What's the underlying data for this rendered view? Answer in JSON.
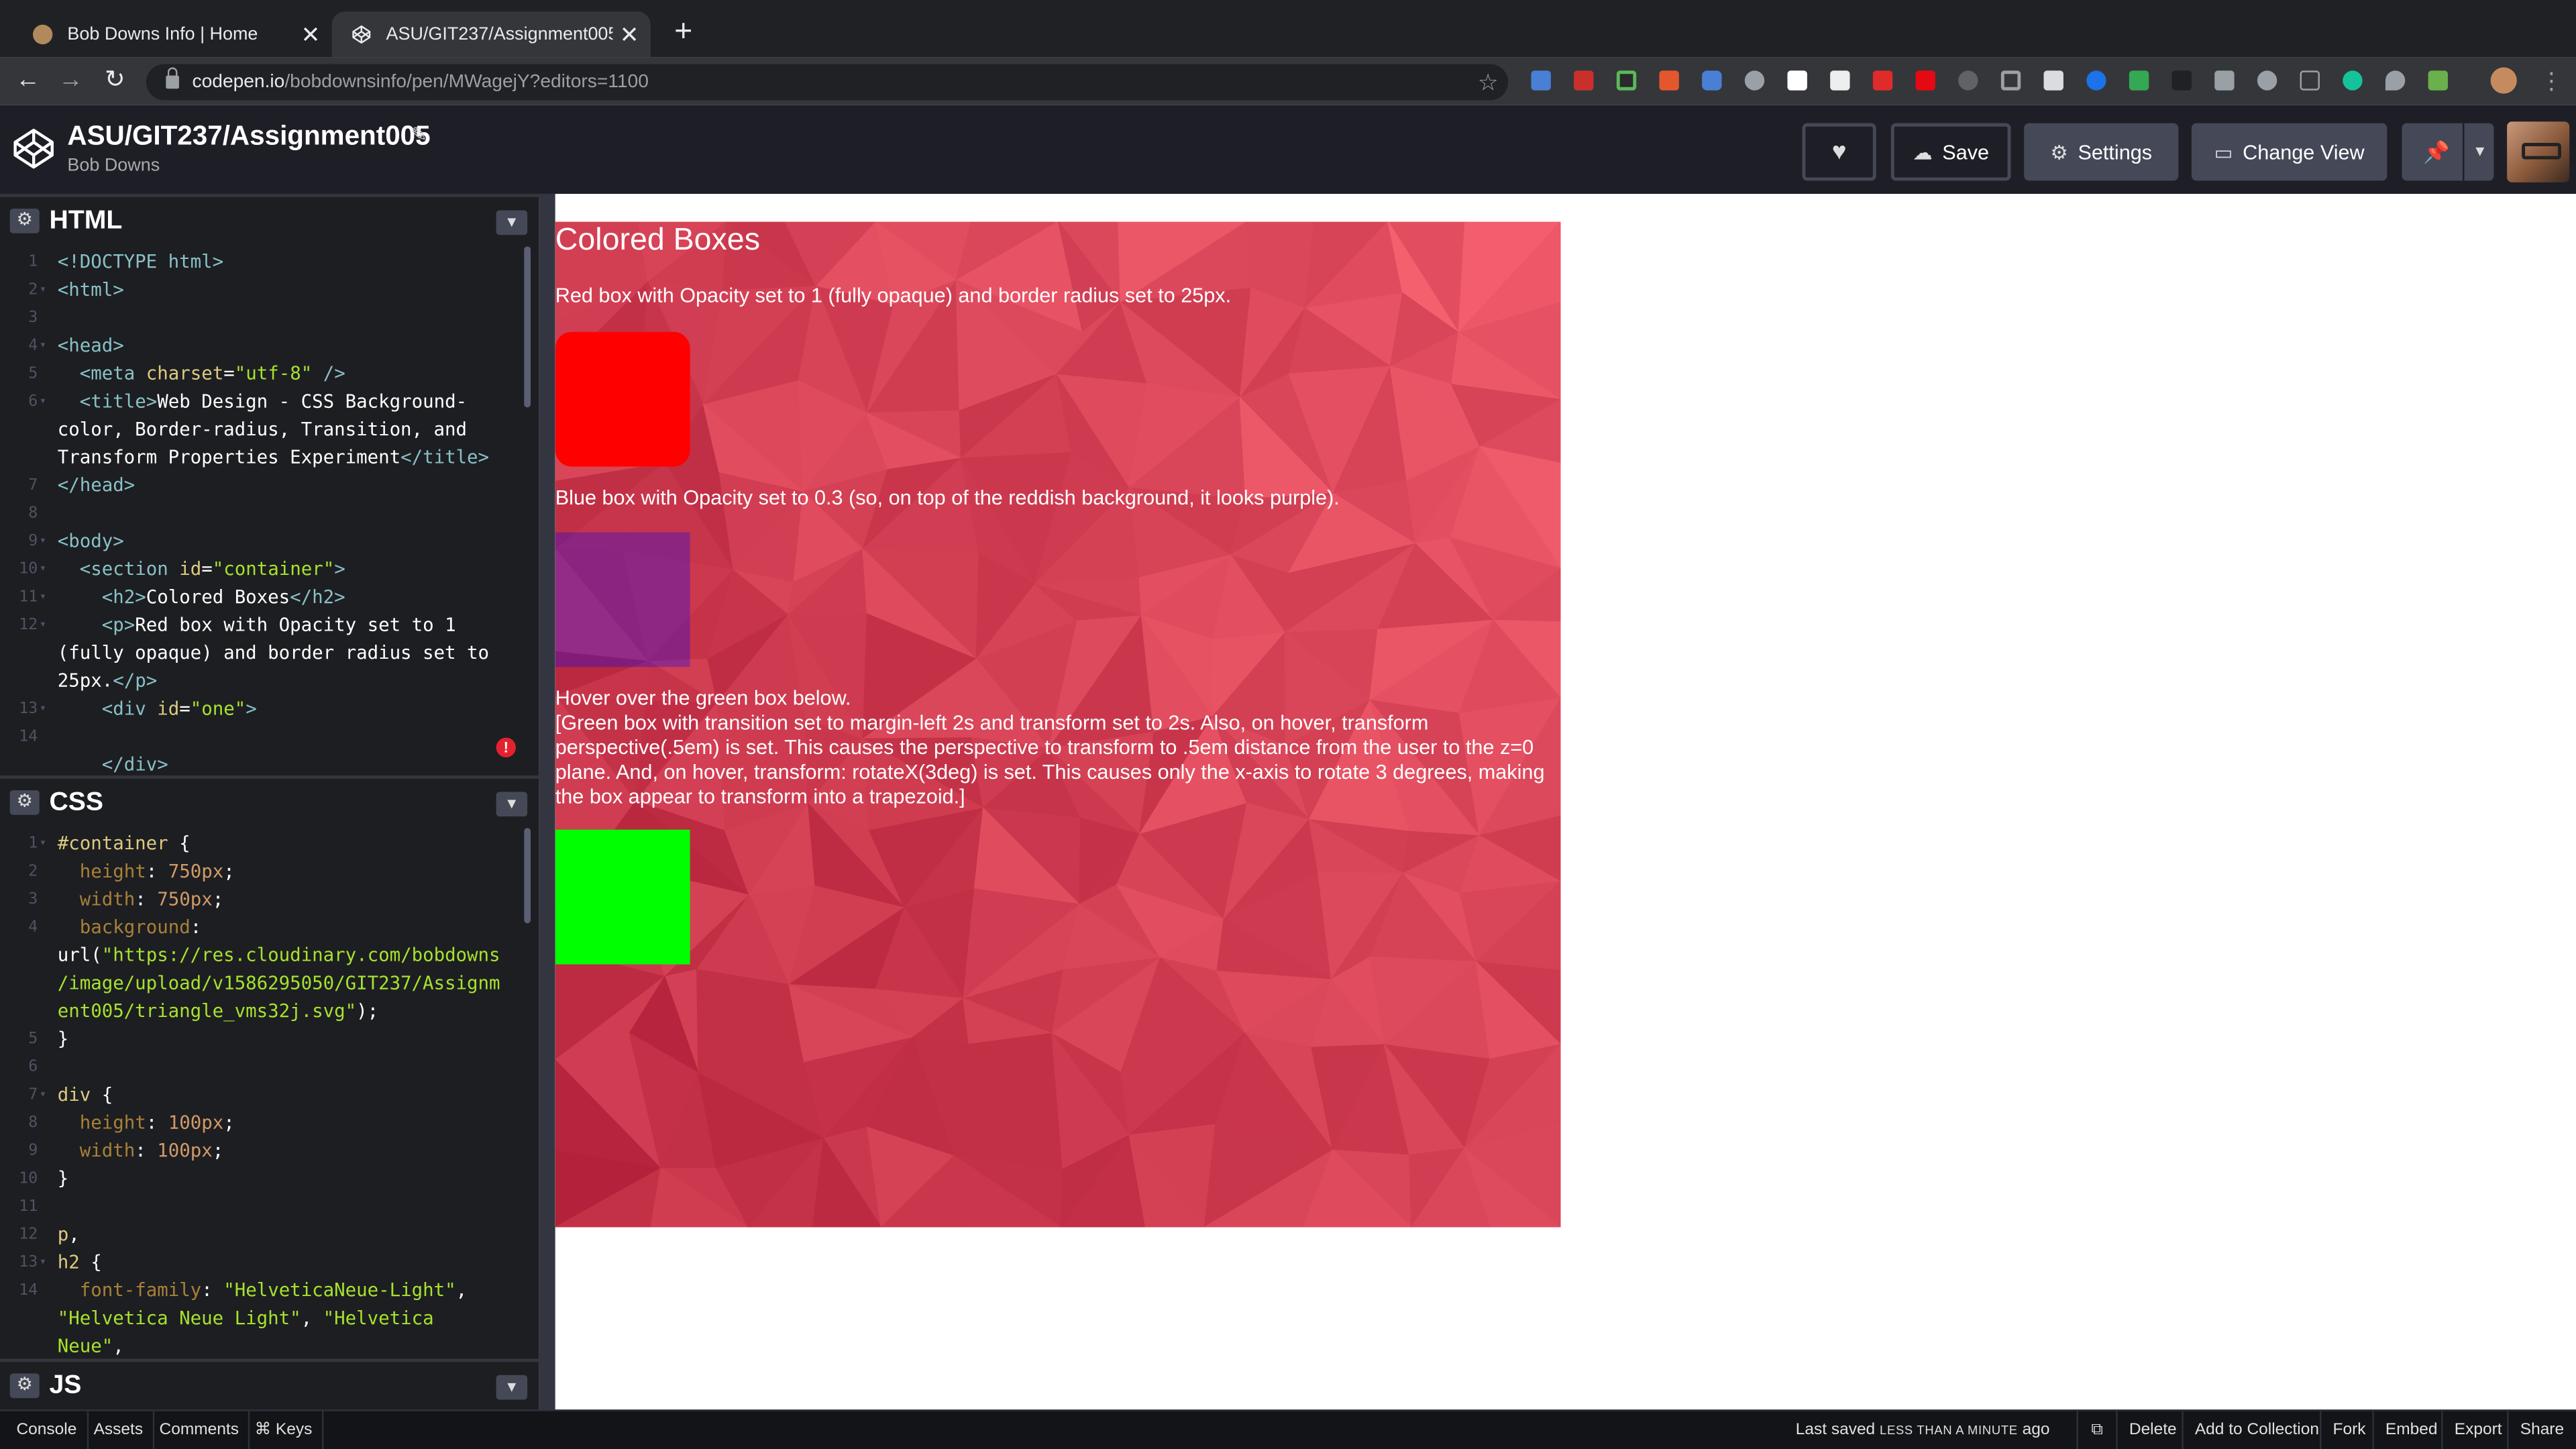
{
  "browser": {
    "tabs": [
      {
        "title": "Bob Downs Info | Home",
        "favicon": "person-favicon"
      },
      {
        "title": "ASU/GIT237/Assignment005",
        "favicon": "codepen-favicon"
      }
    ],
    "url_host": "codepen.io",
    "url_path": "/bobdownsinfo/pen/MWagejY?editors=1100"
  },
  "codepen": {
    "pen_title": "ASU/GIT237/Assignment005",
    "author": "Bob Downs",
    "buttons": {
      "save": "Save",
      "settings": "Settings",
      "change_view": "Change View"
    }
  },
  "panes": {
    "html": {
      "title": "HTML"
    },
    "css": {
      "title": "CSS"
    },
    "js": {
      "title": "JS"
    }
  },
  "html_code": [
    {
      "n": "1",
      "fold": "",
      "segs": [
        [
          "tag",
          "<!DOCTYPE html>"
        ]
      ]
    },
    {
      "n": "2",
      "fold": "▾",
      "segs": [
        [
          "tag",
          "<html>"
        ]
      ]
    },
    {
      "n": "3",
      "fold": "",
      "segs": []
    },
    {
      "n": "4",
      "fold": "▾",
      "segs": [
        [
          "tag",
          "<head>"
        ]
      ]
    },
    {
      "n": "5",
      "fold": "",
      "segs": [
        [
          "plain",
          "  "
        ],
        [
          "tag",
          "<meta "
        ],
        [
          "attr",
          "charset"
        ],
        [
          "plain",
          "="
        ],
        [
          "str",
          "\"utf-8\""
        ],
        [
          "tag",
          " />"
        ]
      ]
    },
    {
      "n": "6",
      "fold": "▾",
      "segs": [
        [
          "plain",
          "  "
        ],
        [
          "tag",
          "<title>"
        ],
        [
          "plain",
          "Web Design - CSS Background-"
        ]
      ]
    },
    {
      "n": "",
      "fold": "",
      "segs": [
        [
          "plain",
          "color, Border-radius, Transition, and"
        ]
      ]
    },
    {
      "n": "",
      "fold": "",
      "segs": [
        [
          "plain",
          "Transform Properties Experiment"
        ],
        [
          "tag",
          "</title>"
        ]
      ]
    },
    {
      "n": "7",
      "fold": "",
      "segs": [
        [
          "tag",
          "</head>"
        ]
      ]
    },
    {
      "n": "8",
      "fold": "",
      "segs": []
    },
    {
      "n": "9",
      "fold": "▾",
      "segs": [
        [
          "tag",
          "<body>"
        ]
      ]
    },
    {
      "n": "10",
      "fold": "▾",
      "segs": [
        [
          "plain",
          "  "
        ],
        [
          "tag",
          "<section "
        ],
        [
          "attr",
          "id"
        ],
        [
          "plain",
          "="
        ],
        [
          "str",
          "\"container\""
        ],
        [
          "tag",
          ">"
        ]
      ]
    },
    {
      "n": "11",
      "fold": "▾",
      "segs": [
        [
          "plain",
          "    "
        ],
        [
          "tag",
          "<h2>"
        ],
        [
          "plain",
          "Colored Boxes"
        ],
        [
          "tag",
          "</h2>"
        ]
      ]
    },
    {
      "n": "12",
      "fold": "▾",
      "segs": [
        [
          "plain",
          "    "
        ],
        [
          "tag",
          "<p>"
        ],
        [
          "plain",
          "Red box with Opacity set to 1"
        ]
      ]
    },
    {
      "n": "",
      "fold": "",
      "segs": [
        [
          "plain",
          "(fully opaque) and border radius set to"
        ]
      ]
    },
    {
      "n": "",
      "fold": "",
      "segs": [
        [
          "plain",
          "25px."
        ],
        [
          "tag",
          "</p>"
        ]
      ]
    },
    {
      "n": "13",
      "fold": "▾",
      "segs": [
        [
          "plain",
          "    "
        ],
        [
          "tag",
          "<div "
        ],
        [
          "attr",
          "id"
        ],
        [
          "plain",
          "="
        ],
        [
          "str",
          "\"one\""
        ],
        [
          "tag",
          ">"
        ]
      ]
    },
    {
      "n": "14",
      "fold": "",
      "segs": []
    },
    {
      "n": "",
      "fold": "",
      "segs": [
        [
          "plain",
          "    "
        ],
        [
          "tag",
          "</div>"
        ]
      ]
    }
  ],
  "css_code": [
    {
      "n": "1",
      "fold": "▾",
      "segs": [
        [
          "sel",
          "#container "
        ],
        [
          "plain",
          "{"
        ]
      ]
    },
    {
      "n": "2",
      "fold": "",
      "segs": [
        [
          "plain",
          "  "
        ],
        [
          "prop",
          "height"
        ],
        [
          "plain",
          ": "
        ],
        [
          "num",
          "750px"
        ],
        [
          "plain",
          ";"
        ]
      ]
    },
    {
      "n": "3",
      "fold": "",
      "segs": [
        [
          "plain",
          "  "
        ],
        [
          "prop",
          "width"
        ],
        [
          "plain",
          ": "
        ],
        [
          "num",
          "750px"
        ],
        [
          "plain",
          ";"
        ]
      ]
    },
    {
      "n": "4",
      "fold": "",
      "segs": [
        [
          "plain",
          "  "
        ],
        [
          "prop",
          "background"
        ],
        [
          "plain",
          ":"
        ]
      ]
    },
    {
      "n": "",
      "fold": "",
      "segs": [
        [
          "plain",
          "url("
        ],
        [
          "str",
          "\"https://res.cloudinary.com/bobdowns"
        ]
      ]
    },
    {
      "n": "",
      "fold": "",
      "segs": [
        [
          "str",
          "/image/upload/v1586295050/GIT237/Assignm"
        ]
      ]
    },
    {
      "n": "",
      "fold": "",
      "segs": [
        [
          "str",
          "ent005/triangle_vms32j.svg\""
        ],
        [
          "plain",
          ");"
        ]
      ]
    },
    {
      "n": "5",
      "fold": "",
      "segs": [
        [
          "plain",
          "}"
        ]
      ]
    },
    {
      "n": "6",
      "fold": "",
      "segs": []
    },
    {
      "n": "7",
      "fold": "▾",
      "segs": [
        [
          "sel",
          "div "
        ],
        [
          "plain",
          "{"
        ]
      ]
    },
    {
      "n": "8",
      "fold": "",
      "segs": [
        [
          "plain",
          "  "
        ],
        [
          "prop",
          "height"
        ],
        [
          "plain",
          ": "
        ],
        [
          "num",
          "100px"
        ],
        [
          "plain",
          ";"
        ]
      ]
    },
    {
      "n": "9",
      "fold": "",
      "segs": [
        [
          "plain",
          "  "
        ],
        [
          "prop",
          "width"
        ],
        [
          "plain",
          ": "
        ],
        [
          "num",
          "100px"
        ],
        [
          "plain",
          ";"
        ]
      ]
    },
    {
      "n": "10",
      "fold": "",
      "segs": [
        [
          "plain",
          "}"
        ]
      ]
    },
    {
      "n": "11",
      "fold": "",
      "segs": []
    },
    {
      "n": "12",
      "fold": "",
      "segs": [
        [
          "sel",
          "p"
        ],
        [
          "plain",
          ","
        ]
      ]
    },
    {
      "n": "13",
      "fold": "▾",
      "segs": [
        [
          "sel",
          "h2 "
        ],
        [
          "plain",
          "{"
        ]
      ]
    },
    {
      "n": "14",
      "fold": "",
      "segs": [
        [
          "plain",
          "  "
        ],
        [
          "prop",
          "font-family"
        ],
        [
          "plain",
          ": "
        ],
        [
          "str",
          "\"HelveticaNeue-Light\""
        ],
        [
          "plain",
          ","
        ]
      ]
    },
    {
      "n": "",
      "fold": "",
      "segs": [
        [
          "str",
          "\"Helvetica Neue Light\""
        ],
        [
          "plain",
          ", "
        ],
        [
          "str",
          "\"Helvetica"
        ]
      ]
    },
    {
      "n": "",
      "fold": "",
      "segs": [
        [
          "str",
          "Neue\""
        ],
        [
          "plain",
          ","
        ]
      ]
    }
  ],
  "preview": {
    "heading": "Colored Boxes",
    "p_red": "Red box with Opacity set to 1 (fully opaque) and border radius set to 25px.",
    "p_blue": "Blue box with Opacity set to 0.3 (so, on top of the reddish background, it looks purple).",
    "p_green_1": "Hover over the green box below.",
    "p_green_2": "[Green box with transition set to margin-left 2s and transform set to 2s. Also, on hover, transform perspective(.5em) is set. This causes the perspective to transform to .5em distance from the user to the z=0 plane. And, on hover, transform: rotateX(3deg) is set. This causes only the x-axis to rotate 3 degrees, making the box appear to transform into a trapezoid.]",
    "colors": {
      "red": "#ff0000",
      "blue_overlay": "rgba(0,0,255,0.3)",
      "green": "#00ff00"
    }
  },
  "footer": {
    "left": [
      "Console",
      "Assets",
      "Comments",
      "⌘ Keys"
    ],
    "last_saved_prefix": "Last saved",
    "last_saved_small": "LESS THAN A MINUTE",
    "last_saved_suffix": "ago",
    "right": [
      "Delete",
      "Add to Collection",
      "Fork",
      "Embed",
      "Export",
      "Share"
    ]
  }
}
